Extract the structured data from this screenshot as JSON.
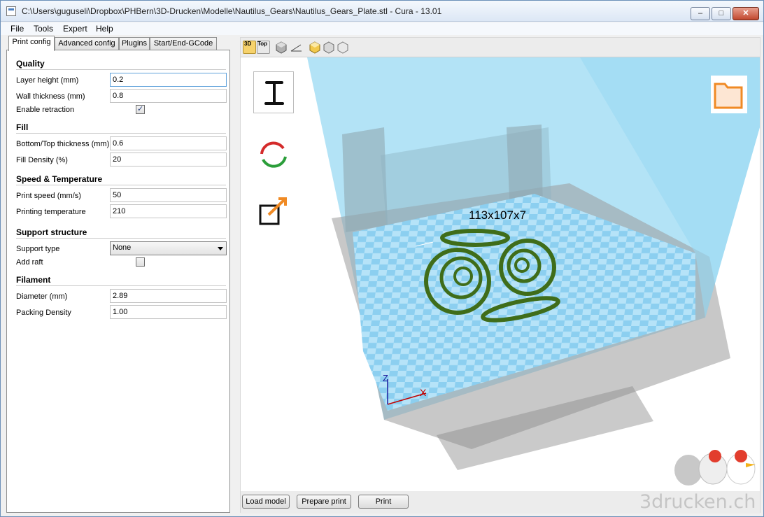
{
  "window": {
    "title": "C:\\Users\\guguseli\\Dropbox\\PHBern\\3D-Drucken\\Modelle\\Nautilus_Gears\\Nautilus_Gears_Plate.stl - Cura - 13.01",
    "minimize": "–",
    "maximize": "□",
    "close": "✕"
  },
  "menu": [
    "File",
    "Tools",
    "Expert",
    "Help"
  ],
  "tabs": [
    "Print config",
    "Advanced config",
    "Plugins",
    "Start/End-GCode"
  ],
  "quality": {
    "heading": "Quality",
    "layer_height_label": "Layer height (mm)",
    "layer_height": "0.2",
    "wall_thickness_label": "Wall thickness (mm)",
    "wall_thickness": "0.8",
    "retraction_label": "Enable retraction",
    "retraction_enabled": true
  },
  "fill": {
    "heading": "Fill",
    "bottom_top_label": "Bottom/Top thickness (mm)",
    "bottom_top": "0.6",
    "density_label": "Fill Density (%)",
    "density": "20"
  },
  "speed": {
    "heading": "Speed & Temperature",
    "print_speed_label": "Print speed (mm/s)",
    "print_speed": "50",
    "temp_label": "Printing temperature",
    "temp": "210"
  },
  "support": {
    "heading": "Support structure",
    "type_label": "Support type",
    "type": "None",
    "raft_label": "Add raft",
    "raft_enabled": false
  },
  "filament": {
    "heading": "Filament",
    "diameter_label": "Diameter (mm)",
    "diameter": "2.89",
    "packing_label": "Packing Density",
    "packing": "1.00"
  },
  "viewer": {
    "view_3d": "3D",
    "view_top": "Top",
    "dimensions": "113x107x7",
    "axis_x": "X",
    "axis_z": "Z"
  },
  "actions": {
    "load": "Load model",
    "prepare": "Prepare print",
    "print": "Print"
  },
  "watermark": "3drucken.ch",
  "colors": {
    "bed": "#87cdef",
    "model": "#5f8f2d",
    "volume": "#8fd6f4"
  }
}
